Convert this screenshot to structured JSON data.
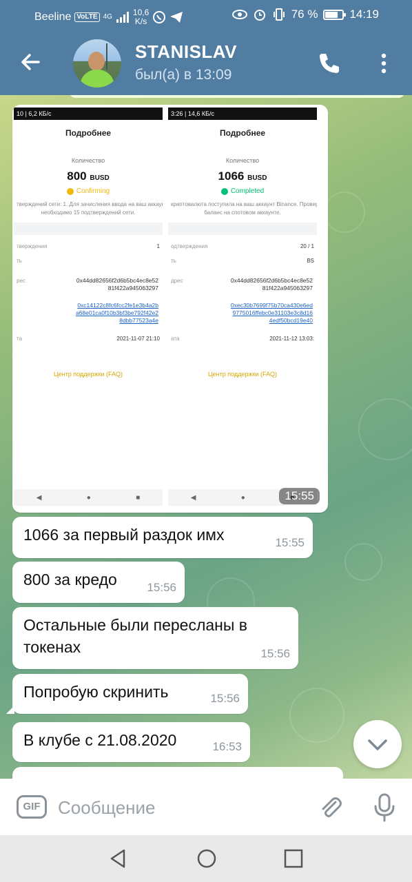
{
  "status_bar": {
    "carrier": "Beeline",
    "volte": "VoLTE",
    "network": "4G",
    "speed": "10,6",
    "speed_unit": "K/s",
    "battery": "76 %",
    "battery_level": 0.76,
    "time": "14:19"
  },
  "header": {
    "name": "STANISLAV",
    "last_seen": "был(а) в 13:09"
  },
  "screenshots": [
    {
      "status": "10 | 6,2 КБ/с",
      "title": "Подробнее",
      "qty_label": "Количество",
      "amount": "800",
      "unit": "BUSD",
      "state": "Confirming",
      "state_color": "#f0b90b",
      "note_1": "тверждений сети: 1. Для зачисления ввода на ваш аккаунт",
      "note_2": "необходимо 15 подтверждений сети.",
      "row_1_label": "тверждения",
      "row_1_value": "1",
      "row_2_label": "ть",
      "row_3_label": "рес",
      "address_1": "0x44dd82656f2d6b5bc4ec8e52",
      "address_2": "81f422a945063297",
      "row_4_label": "",
      "txid_1": "0xc14122c8fc6fcc2fe1e3b4a2b",
      "txid_2": "a68e01ca0f10b3bf3be792f42e2",
      "txid_3": "8dbb77523a4e",
      "row_5_label": "та",
      "date": "2021-11-07 21:10",
      "faq": "Центр поддержки (FAQ)"
    },
    {
      "status": "3:26 | 14,6 КБ/с",
      "title": "Подробнее",
      "qty_label": "Количество",
      "amount": "1066",
      "unit": "BUSD",
      "state": "Completed",
      "state_color": "#02c076",
      "note_1": "криптовалюта поступила на ваш аккаунт Binance. Проверьт",
      "note_2": "баланс на спотовом аккаунте.",
      "row_1_label": "одтверждения",
      "row_1_value": "20 / 1",
      "row_2_label": "ть",
      "row_2_value": "BS",
      "row_3_label": "дрес",
      "address_1": "0x44dd82656f2d6b5bc4ec8e52",
      "address_2": "81f422a945063297",
      "row_4_label": "id",
      "txid_1": "0xec30b7699f75b70ca430e6ed",
      "txid_2": "9775016ffebc0e31103e3c8d16",
      "txid_3": "4edf50bcd19e40",
      "row_5_label": "ата",
      "date": "2021-11-12 13:03:",
      "faq": "Центр поддержки (FAQ)"
    }
  ],
  "photo_time": "15:55",
  "messages": [
    {
      "text": "1066 за первый раздок имх",
      "time": "15:55"
    },
    {
      "text": "800 за кредо",
      "time": "15:56"
    },
    {
      "text_1": "Остальные были пересланы в",
      "text_2": "токенах",
      "time": "15:56"
    },
    {
      "text": "Попробую скринить",
      "time": "15:56"
    },
    {
      "text": "В клубе с 21.08.2020",
      "time": "16:53"
    }
  ],
  "composer": {
    "gif": "GIF",
    "placeholder": "Сообщение"
  },
  "colors": {
    "header": "#517da2",
    "bubble": "#ffffff",
    "time": "#8a96a0"
  }
}
